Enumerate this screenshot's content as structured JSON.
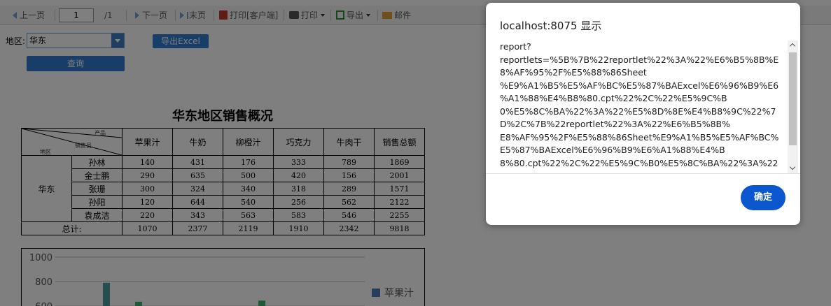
{
  "toolbar": {
    "prev_page": "上一页",
    "page_value": "1",
    "page_total": "/1",
    "next_page": "下一页",
    "last_page": "末页",
    "print_client": "打印[客户端]",
    "print": "打印",
    "export": "导出",
    "email": "邮件"
  },
  "filter": {
    "region_label": "地区:",
    "region_value": "华东",
    "export_excel": "导出Excel",
    "query": "查询"
  },
  "report": {
    "title": "华东地区销售概况",
    "header_corner": {
      "product": "产品",
      "seller": "销售员",
      "region": "地区"
    },
    "columns": [
      "苹果汁",
      "牛奶",
      "柳橙汁",
      "巧克力",
      "牛肉干",
      "销售总额"
    ],
    "region": "华东",
    "rows": [
      {
        "name": "孙林",
        "values": [
          "140",
          "431",
          "176",
          "333",
          "789",
          "1869"
        ]
      },
      {
        "name": "金士鹏",
        "values": [
          "290",
          "635",
          "500",
          "420",
          "156",
          "2001"
        ]
      },
      {
        "name": "张珊",
        "values": [
          "300",
          "324",
          "340",
          "318",
          "289",
          "1571"
        ]
      },
      {
        "name": "孙阳",
        "values": [
          "120",
          "644",
          "540",
          "256",
          "562",
          "2122"
        ]
      },
      {
        "name": "袁成洁",
        "values": [
          "220",
          "343",
          "563",
          "583",
          "546",
          "2255"
        ]
      }
    ],
    "total_label": "总计:",
    "totals": [
      "1070",
      "2377",
      "2119",
      "1910",
      "2342",
      "9818"
    ]
  },
  "chart_data": {
    "type": "bar",
    "y_ticks": [
      "1000",
      "800",
      "600"
    ],
    "ylim": [
      0,
      1000
    ],
    "legend": [
      "苹果汁"
    ],
    "legend_color": "#4a7fb5",
    "bars": [
      {
        "x": 0,
        "value": 789,
        "color": "#4a9e9a"
      },
      {
        "x": 1,
        "value": 635,
        "color": "#3cb371"
      },
      {
        "x": 2,
        "value": 644,
        "color": "#3cb371"
      }
    ]
  },
  "dialog": {
    "title": "localhost:8075 显示",
    "message_lines": [
      "report?",
      "reportlets=%5B%7B%22reportlet%22%3A%22%E6%B5%8B%E",
      "8%AF%95%2F%E5%88%86Sheet",
      "%E9%A1%B5%E5%AF%BC%E5%87%BAExcel%E6%96%B9%E6",
      "%A1%88%E4%B8%80.cpt%22%2C%22%E5%9C%B",
      "0%E5%8C%BA%22%3A%22%E5%8D%8E%E4%B8%9C%22%7",
      "D%2C%7B%22reportlet%22%3A%22%E6%B5%8B%",
      "E8%AF%95%2F%E5%88%86Sheet%E9%A1%B5%E5%AF%BC%",
      "E5%87%BAExcel%E6%96%B9%E6%A1%88%E4%B",
      "8%80.cpt%22%2C%22%E5%9C%B0%E5%8C%BA%22%3A%22"
    ],
    "ok_label": "确定"
  }
}
